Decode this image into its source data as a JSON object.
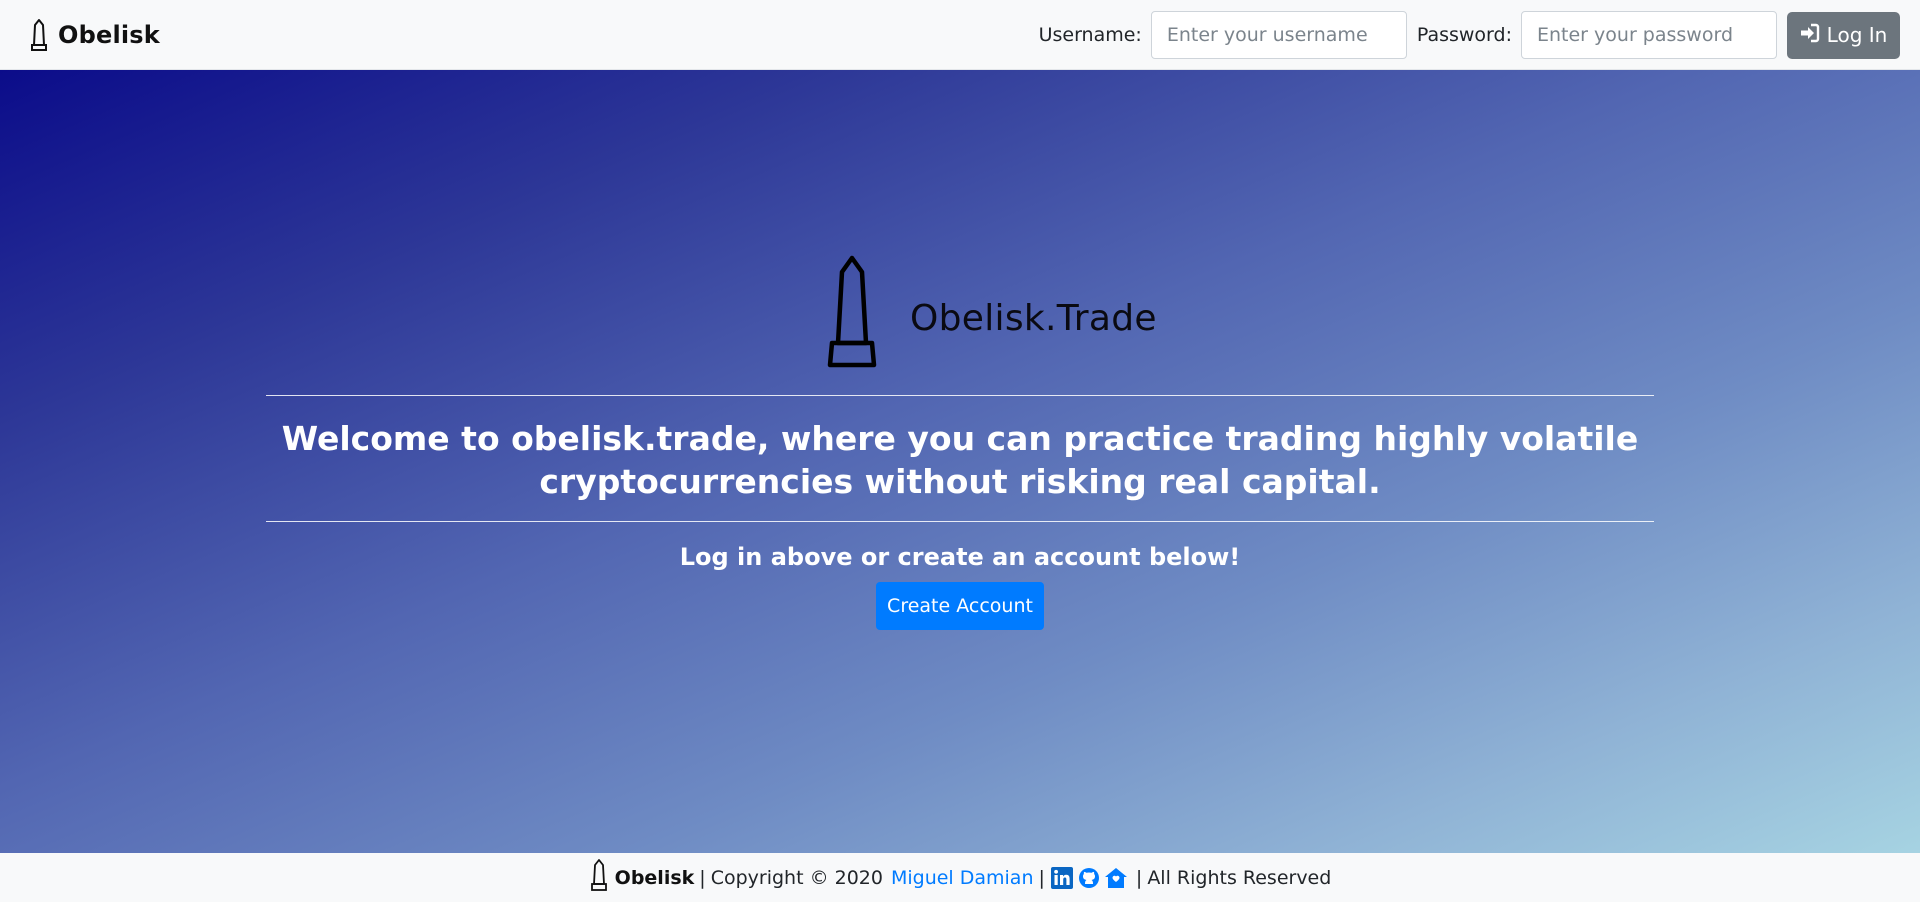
{
  "navbar": {
    "brand": "Obelisk",
    "brand_icon": "obelisk-icon",
    "username_label": "Username:",
    "username_placeholder": "Enter your username",
    "username_value": "",
    "password_label": "Password:",
    "password_placeholder": "Enter your password",
    "password_value": "",
    "login_button": "Log In",
    "login_icon": "sign-in-icon"
  },
  "hero": {
    "title": "Obelisk.Trade",
    "logo_icon": "obelisk-icon",
    "welcome_line1": "Welcome to obelisk.trade, where you can practice trading highly volatile",
    "welcome_line2": "cryptocurrencies without risking real capital.",
    "subline": "Log in above or create an account below!",
    "create_button": "Create Account"
  },
  "footer": {
    "brand": "Obelisk",
    "copyright": "Copyright © 2020",
    "author": "Miguel Damian",
    "rights": "All Rights Reserved",
    "icons": [
      "linkedin-icon",
      "github-icon",
      "home-icon"
    ]
  },
  "colors": {
    "primary": "#007bff",
    "secondary": "#6c757d",
    "gradient_start": "#0b0c8a",
    "gradient_end": "#a6d3e2"
  }
}
